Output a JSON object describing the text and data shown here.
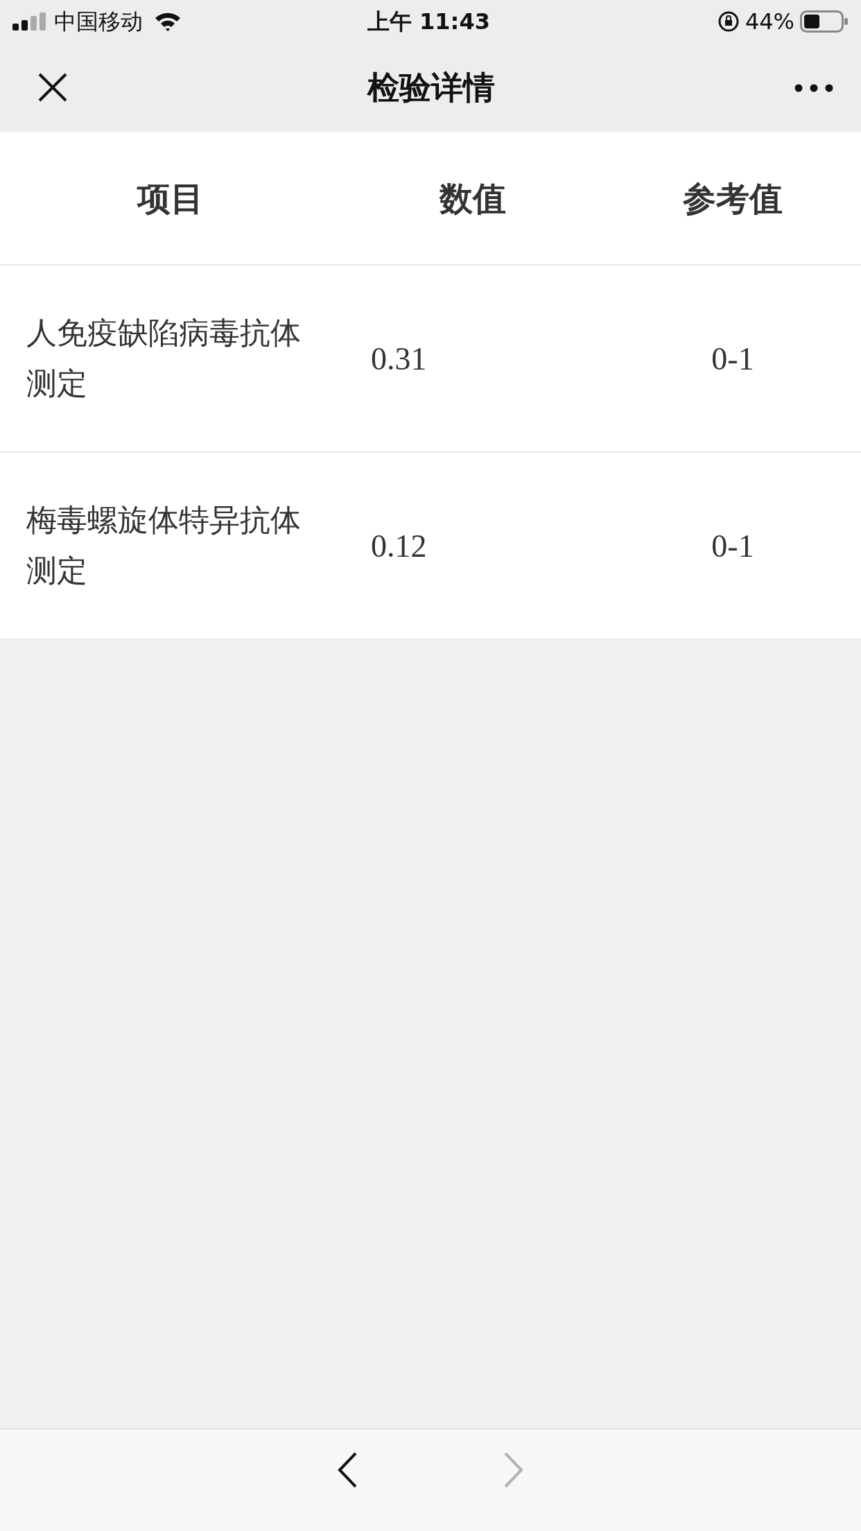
{
  "status_bar": {
    "carrier": "中国移动",
    "time": "上午 11:43",
    "battery": "44%"
  },
  "nav_bar": {
    "title": "检验详情"
  },
  "table": {
    "columns": [
      "项目",
      "数值",
      "参考值"
    ],
    "rows": [
      {
        "item": "人免疫缺陷病毒抗体测定",
        "value": "0.31",
        "reference": "0-1"
      },
      {
        "item": "梅毒螺旋体特异抗体测定",
        "value": "0.12",
        "reference": "0-1"
      }
    ]
  },
  "toolbar": {
    "back": {
      "disabled": false
    },
    "forward": {
      "disabled": true
    }
  }
}
